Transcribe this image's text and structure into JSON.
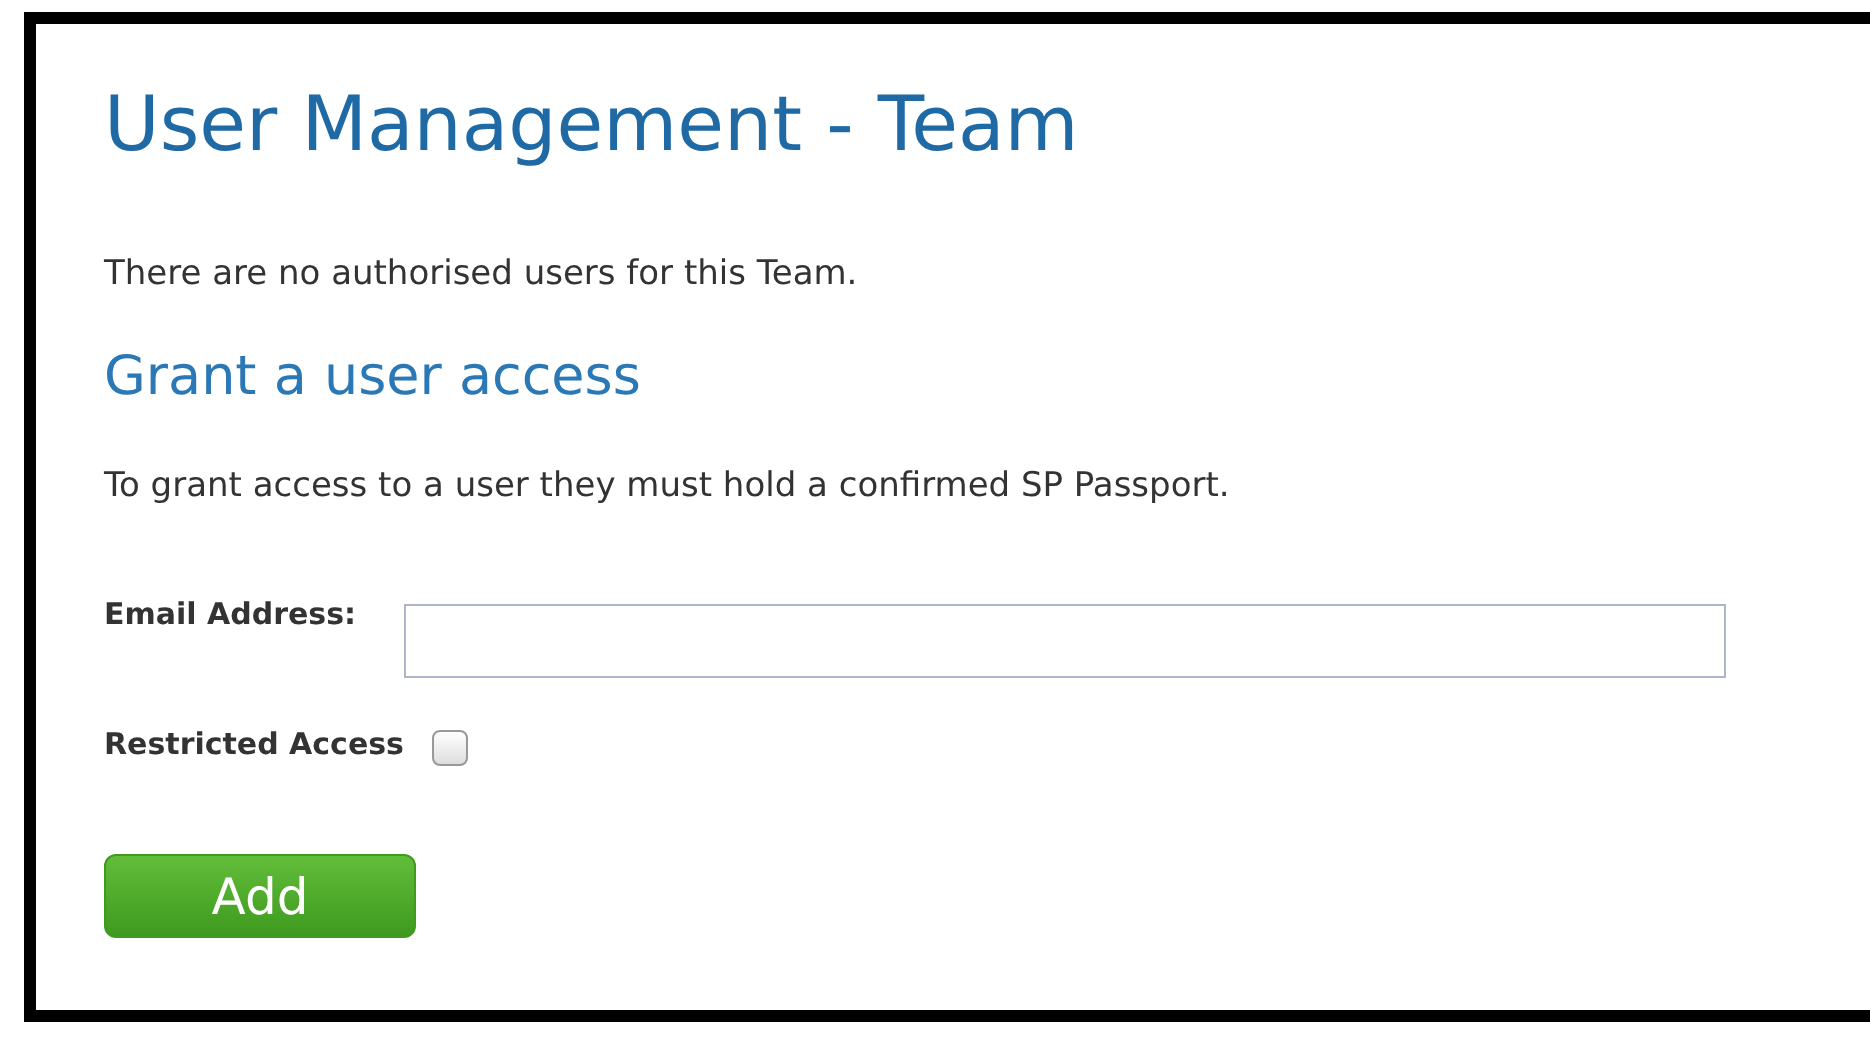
{
  "title": "User Management - Team",
  "notice": "There are no authorised users for this Team.",
  "section_title": "Grant a user access",
  "instructions": "To grant access to a user they must hold a confirmed SP Passport.",
  "email_field": {
    "label": "Email Address:"
  },
  "restricted_access": {
    "label": "Restricted Access",
    "checked": false
  },
  "add_button": "Add"
}
